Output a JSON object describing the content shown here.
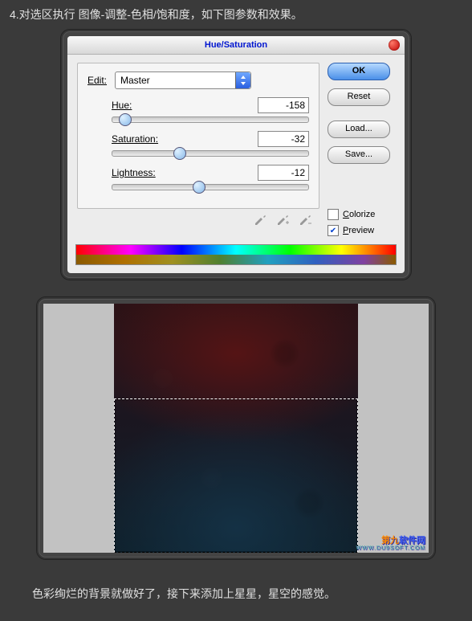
{
  "instructions": {
    "top": "4.对选区执行 图像-调整-色相/饱和度，如下图参数和效果。",
    "bottom": "色彩绚烂的背景就做好了，接下来添加上星星，星空的感觉。"
  },
  "dialog": {
    "title": "Hue/Saturation",
    "edit_label": "Edit:",
    "edit_value": "Master",
    "sliders": {
      "hue": {
        "label": "Hue:",
        "value": "-158",
        "min": -180,
        "max": 180
      },
      "saturation": {
        "label": "Saturation:",
        "value": "-32",
        "min": -100,
        "max": 100
      },
      "lightness": {
        "label": "Lightness:",
        "value": "-12",
        "min": -100,
        "max": 100
      }
    },
    "buttons": {
      "ok": "OK",
      "reset": "Reset",
      "load": "Load...",
      "save": "Save..."
    },
    "checks": {
      "colorize": {
        "label_u": "C",
        "label_rest": "olorize",
        "checked": false
      },
      "preview": {
        "label_u": "P",
        "label_rest": "review",
        "checked": true
      }
    }
  },
  "watermark": {
    "line1": "第九",
    "accent": "软件网",
    "sub": "WWW.DU9SOFT.COM"
  }
}
